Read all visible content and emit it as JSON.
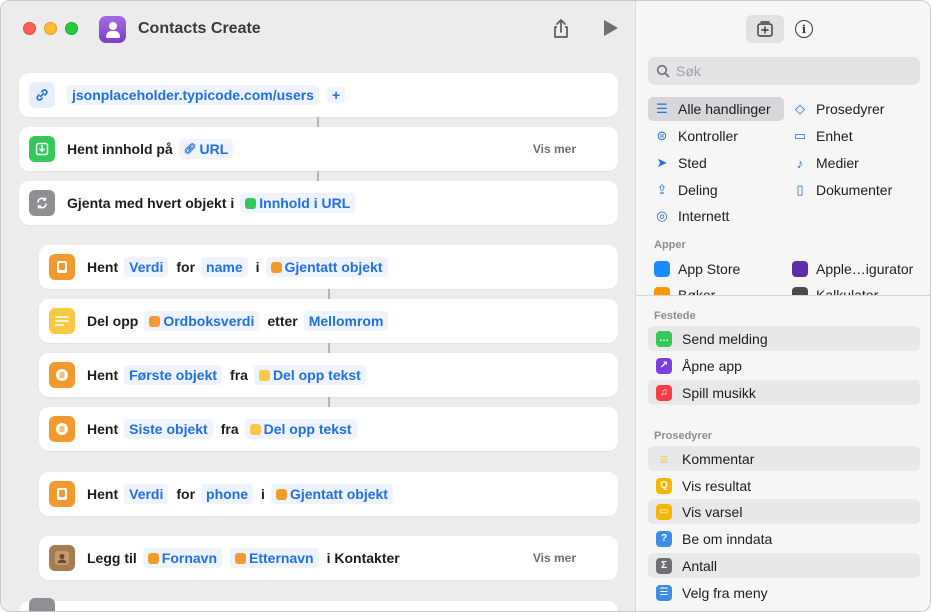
{
  "window": {
    "title": "Contacts Create"
  },
  "actions": [
    {
      "id": "url",
      "url_text": "jsonplaceholder.typicode.com/users",
      "add_label": "+"
    },
    {
      "id": "get-contents",
      "text": "Hent innhold på",
      "token": "URL",
      "more": "Vis mer"
    },
    {
      "id": "repeat",
      "text": "Gjenta med hvert objekt i",
      "token": "Innhold i URL"
    },
    {
      "id": "get-value-name",
      "w1": "Hent",
      "t1": "Verdi",
      "w2": "for",
      "t2": "name",
      "w3": "i",
      "t3": "Gjentatt objekt"
    },
    {
      "id": "split-text",
      "w1": "Del opp",
      "t1": "Ordboksverdi",
      "w2": "etter",
      "t2": "Mellomrom"
    },
    {
      "id": "get-first",
      "w1": "Hent",
      "t1": "Første objekt",
      "w2": "fra",
      "t2": "Del opp tekst"
    },
    {
      "id": "get-last",
      "w1": "Hent",
      "t1": "Siste objekt",
      "w2": "fra",
      "t2": "Del opp tekst"
    },
    {
      "id": "get-value-phone",
      "w1": "Hent",
      "t1": "Verdi",
      "w2": "for",
      "t2": "phone",
      "w3": "i",
      "t3": "Gjentatt objekt"
    },
    {
      "id": "add-contact",
      "w1": "Legg til",
      "t1": "Fornavn",
      "t2": "Etternavn",
      "w2": "i Kontakter",
      "more": "Vis mer"
    }
  ],
  "library": {
    "search_placeholder": "Søk",
    "categories": [
      {
        "label": "Alle handlinger",
        "icon": "list-icon",
        "selected": true
      },
      {
        "label": "Prosedyrer",
        "icon": "scripting-icon"
      },
      {
        "label": "Kontroller",
        "icon": "toggle-icon"
      },
      {
        "label": "Enhet",
        "icon": "display-icon"
      },
      {
        "label": "Sted",
        "icon": "location-arrow-icon"
      },
      {
        "label": "Medier",
        "icon": "music-note-icon"
      },
      {
        "label": "Deling",
        "icon": "share-icon"
      },
      {
        "label": "Dokumenter",
        "icon": "document-icon"
      },
      {
        "label": "Internett",
        "icon": "compass-icon"
      }
    ],
    "apps_label": "Apper",
    "apps": [
      {
        "label": "App Store",
        "color": "#1a8cff"
      },
      {
        "label": "Apple…igurator",
        "color": "#5c2fa8"
      },
      {
        "label": "Bøker",
        "color": "#ff9500"
      },
      {
        "label": "Kalkulator",
        "color": "#4a4a4a"
      }
    ],
    "pinned_label": "Festede",
    "pinned": [
      {
        "label": "Send melding",
        "color": "#34c759",
        "icon": "message-icon"
      },
      {
        "label": "Åpne app",
        "color": "#7b3fe4",
        "icon": "open-app-icon"
      },
      {
        "label": "Spill musikk",
        "color": "#fc3c44",
        "icon": "music-icon"
      }
    ],
    "scripting_label": "Prosedyrer",
    "scripting": [
      {
        "label": "Kommentar",
        "color": "#f7c945",
        "icon": "comment-icon"
      },
      {
        "label": "Vis resultat",
        "color": "#f7b500",
        "icon": "show-result-icon"
      },
      {
        "label": "Vis varsel",
        "color": "#f7b500",
        "icon": "alert-icon"
      },
      {
        "label": "Be om inndata",
        "color": "#3a8ee6",
        "icon": "ask-input-icon"
      },
      {
        "label": "Antall",
        "color": "#6e6e73",
        "icon": "sigma-icon"
      },
      {
        "label": "Velg fra meny",
        "color": "#3a8ee6",
        "icon": "menu-icon"
      }
    ]
  }
}
